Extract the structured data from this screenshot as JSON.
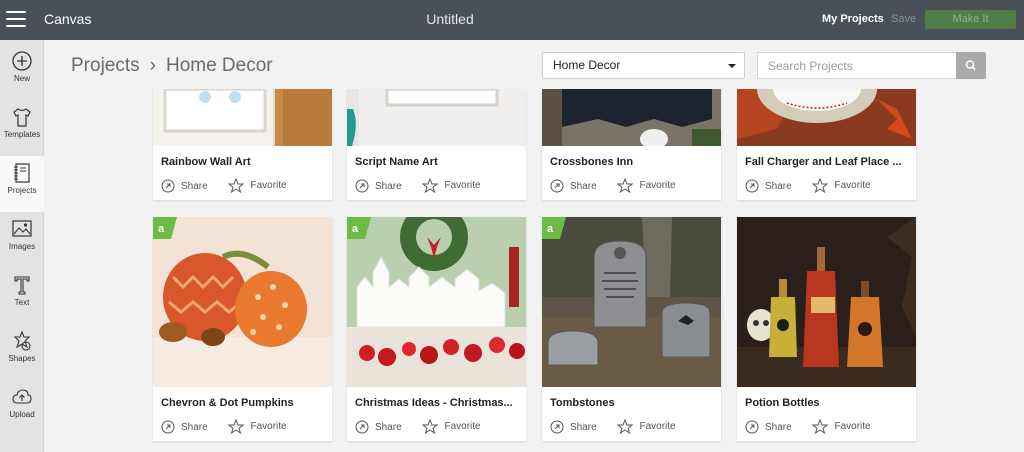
{
  "topbar": {
    "app_name": "Canvas",
    "doc_title": "Untitled",
    "my_projects": "My Projects",
    "save": "Save",
    "make_it": "Make It"
  },
  "sidebar": {
    "items": [
      {
        "label": "New",
        "icon": "plus-circle-icon"
      },
      {
        "label": "Templates",
        "icon": "shirt-icon"
      },
      {
        "label": "Projects",
        "icon": "notebook-icon"
      },
      {
        "label": "Images",
        "icon": "image-icon"
      },
      {
        "label": "Text",
        "icon": "text-icon"
      },
      {
        "label": "Shapes",
        "icon": "shapes-icon"
      },
      {
        "label": "Upload",
        "icon": "cloud-upload-icon"
      }
    ]
  },
  "header": {
    "breadcrumb_root": "Projects",
    "breadcrumb_current": "Home Decor",
    "category_select": "Home Decor",
    "search_placeholder": "Search Projects"
  },
  "card_actions": {
    "share": "Share",
    "favorite": "Favorite"
  },
  "cards_row1": [
    {
      "title": "Rainbow Wall Art"
    },
    {
      "title": "Script Name Art"
    },
    {
      "title": "Crossbones Inn"
    },
    {
      "title": "Fall Charger and Leaf Place ..."
    }
  ],
  "cards_row2": [
    {
      "title": "Chevron & Dot Pumpkins",
      "badge": true
    },
    {
      "title": "Christmas Ideas - Christmas...",
      "badge": true
    },
    {
      "title": "Tombstones",
      "badge": true
    },
    {
      "title": "Potion Bottles",
      "badge": false
    }
  ],
  "colors": {
    "topbar": "#495057",
    "make_it": "#4e7d48",
    "badge": "#6dbb45"
  }
}
